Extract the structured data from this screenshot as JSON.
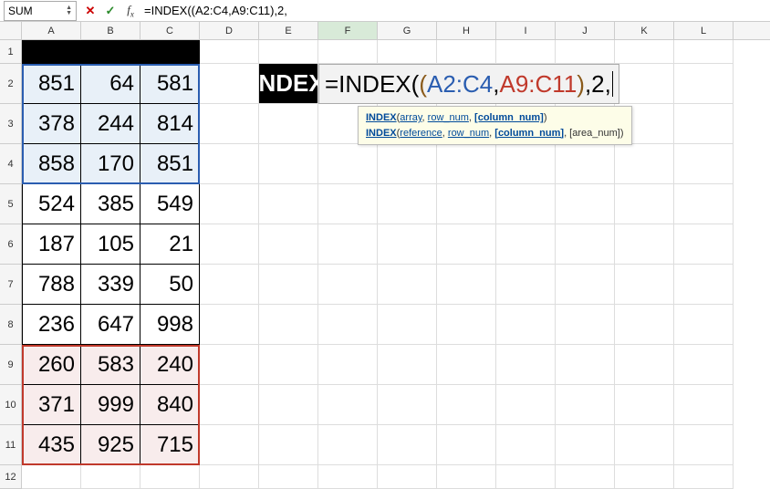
{
  "name_box": "SUM",
  "formula_input": "=INDEX((A2:C4,A9:C11),2,",
  "columns": [
    "A",
    "B",
    "C",
    "D",
    "E",
    "F",
    "G",
    "H",
    "I",
    "J",
    "K",
    "L"
  ],
  "active_column": "F",
  "row_numbers": [
    "1",
    "2",
    "3",
    "4",
    "5",
    "6",
    "7",
    "8",
    "9",
    "10",
    "11",
    "12"
  ],
  "index_label": "INDEX",
  "formula_edit_parts": {
    "p1": "=INDEX(",
    "p2": "(",
    "p3": "A2:C4",
    "p4": ",",
    "p5": "A9:C11",
    "p6": ")",
    "p7": ",2,"
  },
  "tooltip": {
    "l1_fn": "INDEX",
    "l1_open": "(",
    "l1_a1": "array",
    "l1_c1": ", ",
    "l1_a2": "row_num",
    "l1_c2": ", ",
    "l1_a3": "[column_num]",
    "l1_close": ")",
    "l2_fn": "INDEX",
    "l2_open": "(",
    "l2_a1": "reference",
    "l2_c1": ", ",
    "l2_a2": "row_num",
    "l2_c2": ", ",
    "l2_a3": "[column_num]",
    "l2_c3": ", [area_num]",
    "l2_close": ")"
  },
  "chart_data": {
    "type": "table",
    "title": "",
    "columns": [
      "A",
      "B",
      "C"
    ],
    "rows": [
      {
        "row": 2,
        "values": [
          851,
          64,
          581
        ],
        "group": "range1_blue"
      },
      {
        "row": 3,
        "values": [
          378,
          244,
          814
        ],
        "group": "range1_blue"
      },
      {
        "row": 4,
        "values": [
          858,
          170,
          851
        ],
        "group": "range1_blue"
      },
      {
        "row": 5,
        "values": [
          524,
          385,
          549
        ],
        "group": "none"
      },
      {
        "row": 6,
        "values": [
          187,
          105,
          21
        ],
        "group": "none"
      },
      {
        "row": 7,
        "values": [
          788,
          339,
          50
        ],
        "group": "none"
      },
      {
        "row": 8,
        "values": [
          236,
          647,
          998
        ],
        "group": "none"
      },
      {
        "row": 9,
        "values": [
          260,
          583,
          240
        ],
        "group": "range2_red"
      },
      {
        "row": 10,
        "values": [
          371,
          999,
          840
        ],
        "group": "range2_red"
      },
      {
        "row": 11,
        "values": [
          435,
          925,
          715
        ],
        "group": "range2_red"
      }
    ],
    "ranges": {
      "range1_blue": "A2:C4",
      "range2_red": "A9:C11"
    }
  },
  "colors": {
    "range_blue": "#2a5db0",
    "range_red": "#c0392b",
    "tooltip_bg": "#fdfde8"
  }
}
